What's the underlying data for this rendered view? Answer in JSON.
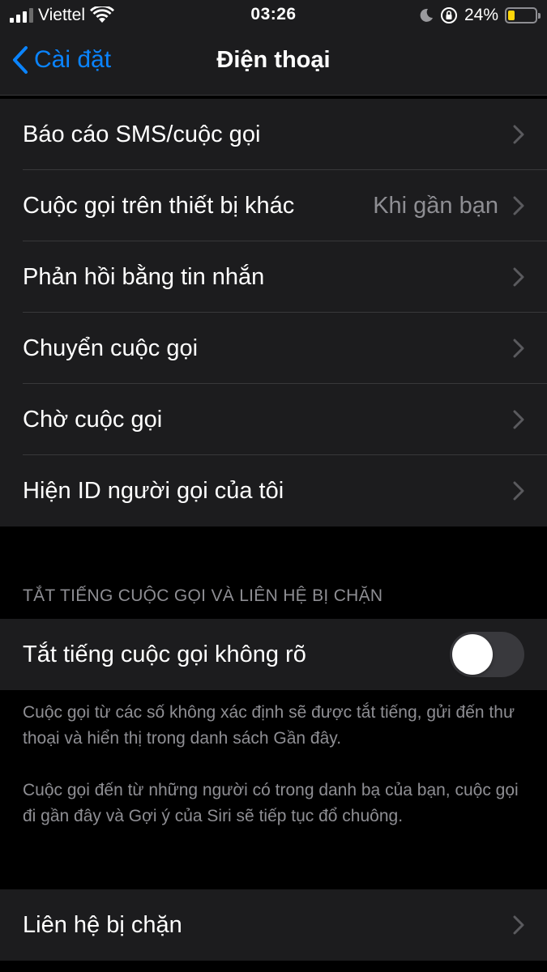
{
  "status_bar": {
    "carrier": "Viettel",
    "time": "03:26",
    "battery_percent": "24%",
    "battery_level": 0.24,
    "battery_color": "#ffd60a"
  },
  "nav": {
    "back_label": "Cài đặt",
    "title": "Điện thoại"
  },
  "settings_rows": [
    {
      "label": "Báo cáo SMS/cuộc gọi"
    },
    {
      "label": "Cuộc gọi trên thiết bị khác",
      "value": "Khi gần bạn"
    },
    {
      "label": "Phản hồi bằng tin nhắn"
    },
    {
      "label": "Chuyển cuộc gọi"
    },
    {
      "label": "Chờ cuộc gọi"
    },
    {
      "label": "Hiện ID người gọi của tôi"
    }
  ],
  "silence_section": {
    "header": "TẮT TIẾNG CUỘC GỌI VÀ LIÊN HỆ BỊ CHẶN",
    "toggle_label": "Tắt tiếng cuộc gọi không rõ",
    "toggle_on": false,
    "note_1": "Cuộc gọi từ các số không xác định sẽ được tắt tiếng, gửi đến thư thoại và hiển thị trong danh sách Gần đây.",
    "note_2": "Cuộc gọi đến từ những người có trong danh bạ của bạn, cuộc gọi đi gần đây và Gợi ý của Siri sẽ tiếp tục đổ chuông."
  },
  "blocked": {
    "label": "Liên hệ bị chặn"
  },
  "colors": {
    "accent": "#0a84ff",
    "background": "#000000",
    "cell": "#1c1c1e",
    "secondary_text": "#8e8e93"
  },
  "icons": {
    "signal": "cellular-signal-icon",
    "wifi": "wifi-icon",
    "moon": "moon-icon",
    "rotation_lock": "rotation-lock-icon",
    "battery": "battery-icon",
    "back": "chevron-left-icon",
    "disclosure": "chevron-right-icon"
  }
}
